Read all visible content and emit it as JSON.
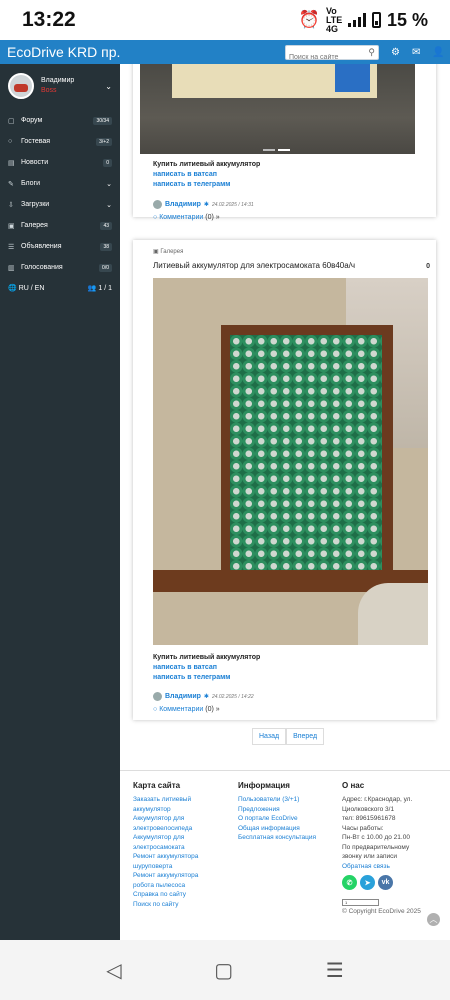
{
  "status_bar": {
    "time": "13:22",
    "network_label": "Vo LTE 4G",
    "battery": "15 %"
  },
  "topnav": {
    "brand": "EcoDrive KRD пр...",
    "search_placeholder": "Поиск на сайте"
  },
  "sidebar": {
    "user": {
      "name": "Владимир",
      "role": "Boss"
    },
    "items": [
      {
        "icon": "chat-icon",
        "label": "Форум",
        "badge": "30/34"
      },
      {
        "icon": "comment-icon",
        "label": "Гостевая",
        "badge": "3/+2"
      },
      {
        "icon": "news-icon",
        "label": "Новости",
        "badge": "0"
      },
      {
        "icon": "pencil-icon",
        "label": "Блоги",
        "badge": ""
      },
      {
        "icon": "download-icon",
        "label": "Загрузки",
        "badge": ""
      },
      {
        "icon": "image-icon",
        "label": "Галерея",
        "badge": "43"
      },
      {
        "icon": "list-icon",
        "label": "Объявления",
        "badge": "38"
      },
      {
        "icon": "chart-icon",
        "label": "Голосования",
        "badge": "0/0"
      }
    ],
    "lang": "RU / EN",
    "online": "1 / 1"
  },
  "post1": {
    "title": "Купить литиевый аккумулятор",
    "link_whatsapp": "написать в ватсап",
    "link_telegram": "написать в телеграмм",
    "author": "Владимир",
    "date": "24.02.2025 / 14:31",
    "comments_label": "Комментарии",
    "comments_count": "(0) »"
  },
  "post2": {
    "category": "Галерея",
    "heading": "Литиевый аккумулятор для электросамоката 60в40а/ч",
    "count": "0",
    "title": "Купить литиевый аккумулятор",
    "link_whatsapp": "написать в ватсап",
    "link_telegram": "написать в телеграмм",
    "author": "Владимир",
    "date": "24.02.2025 / 14:22",
    "comments_label": "Комментарии",
    "comments_count": "(0) »"
  },
  "pager": {
    "prev": "Назад",
    "next": "Вперед"
  },
  "footer": {
    "sitemap": {
      "heading": "Карта сайта",
      "links": [
        "Заказать литиевый",
        "аккумулятор",
        "Аккумулятор для",
        "электровелосипеда",
        "Аккумулятор для",
        "электросамоката",
        "Ремонт аккумулятора",
        "шуруповерта",
        "Ремонт аккумулятора",
        "робота пылесоса",
        "Справка по сайту",
        "Поиск по сайту"
      ]
    },
    "info": {
      "heading": "Информация",
      "links": [
        "Пользователи (3/+1)",
        "Предложения",
        "О портале EcoDrive",
        "Общая информация",
        "Бесплатная консультация"
      ]
    },
    "about": {
      "heading": "О нас",
      "lines": [
        "Адрес: г.Краснодар, ул.",
        "Циолковского 3/1",
        "тел: 89615961678",
        "Часы работы:",
        "Пн-Вт с 10.00 до 21.00",
        "По предварительному",
        "звонку или записи"
      ],
      "feedback": "Обратная связь",
      "copyright": "© Copyright EcoDrive 2025",
      "counter_text": "1"
    }
  },
  "colors": {
    "topnav": "#2281c6",
    "sidebar": "#263238",
    "link": "#1a7fd4",
    "whatsapp": "#25d366",
    "telegram": "#2aa1da",
    "vk": "#4a76a8"
  }
}
